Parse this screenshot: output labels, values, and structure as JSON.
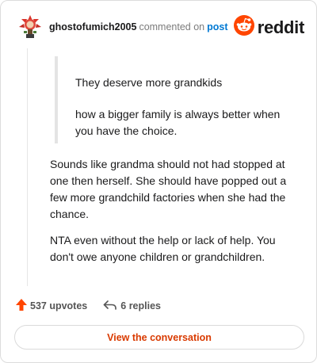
{
  "header": {
    "username": "ghostofumich2005",
    "action": "commented on",
    "post_link": "post",
    "brand": "reddit",
    "avatar_icon": "redditor-avatar-icon",
    "brand_icon": "reddit-snoo-icon"
  },
  "quote": {
    "line1": "They deserve more grandkids",
    "line2": "how a bigger family is always better when you have the choice."
  },
  "body": {
    "paragraph1": "Sounds like grandma should not had stopped at one then herself. She should have popped out a few more grandchild factories when she had the chance.",
    "paragraph2": "NTA even without the help or lack of help. You don't owe anyone children or grandchildren."
  },
  "footer": {
    "upvotes": "537 upvotes",
    "replies": "6 replies",
    "upvote_icon": "upvote-arrow-icon",
    "reply_icon": "reply-arrow-icon"
  },
  "cta": {
    "view_label": "View the conversation"
  },
  "colors": {
    "brand_orange": "#ff4500",
    "link_blue": "#0079d3",
    "cta_text": "#d93a00"
  }
}
